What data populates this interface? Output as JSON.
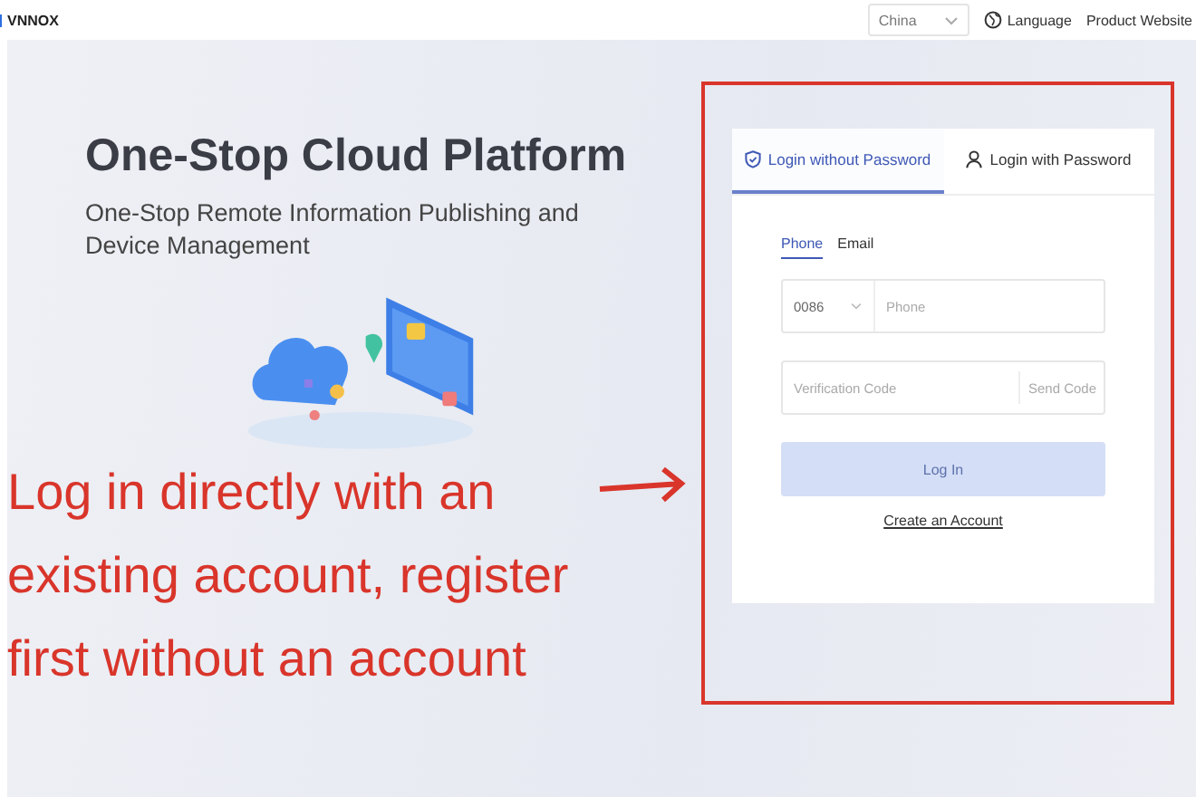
{
  "header": {
    "logo": "VNNOX",
    "region_select": {
      "value": "China"
    },
    "language_link": "Language",
    "product_link": "Product Website"
  },
  "hero": {
    "title": "One-Stop Cloud Platform",
    "subtitle": "One-Stop Remote Information Publishing and Device Management"
  },
  "annotation": {
    "text": "Log in directly with an existing account, register first without an account"
  },
  "login": {
    "tabs": [
      {
        "label": "Login without Password",
        "selected": true
      },
      {
        "label": "Login with Password",
        "selected": false
      }
    ],
    "method_tabs": [
      {
        "label": "Phone",
        "selected": true
      },
      {
        "label": "Email",
        "selected": false
      }
    ],
    "country_code": "0086",
    "phone_field": {
      "placeholder": "Phone"
    },
    "code_field": {
      "placeholder": "Verification Code"
    },
    "send_code": "Send Code",
    "login_button": {
      "label": "Log In",
      "disabled": true
    },
    "create_account": "Create an Account"
  }
}
